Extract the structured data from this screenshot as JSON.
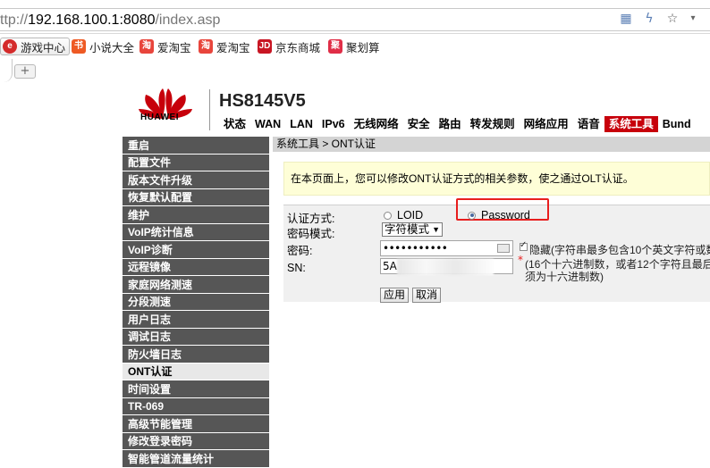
{
  "browser": {
    "url_prefix": "ttp://",
    "url_host": "192.168.100.1:8080",
    "url_path": "/index.asp",
    "bookmarks": [
      {
        "label": "游戏中心",
        "icon": "game-center-icon",
        "color": "#d42b2b"
      },
      {
        "label": "小说大全",
        "icon": "novel-icon",
        "color": "#ee5a24"
      },
      {
        "label": "爱淘宝",
        "icon": "taobao-icon",
        "color": "#e8453c"
      },
      {
        "label": "爱淘宝",
        "icon": "taobao-icon",
        "color": "#e8453c"
      },
      {
        "label": "京东商城",
        "icon": "jd-icon",
        "color": "#c81623"
      },
      {
        "label": "聚划算",
        "icon": "juhuasuan-icon",
        "color": "#e02e47"
      }
    ],
    "new_tab_label": "+"
  },
  "router": {
    "brand": "HUAWEI",
    "model": "HS8145V5",
    "accent_color": "#c7000b",
    "nav": [
      "状态",
      "WAN",
      "LAN",
      "IPv6",
      "无线网络",
      "安全",
      "路由",
      "转发规则",
      "网络应用",
      "语音",
      "系统工具",
      "Bund"
    ],
    "active_nav": "系统工具",
    "sidebar": [
      "重启",
      "配置文件",
      "版本文件升级",
      "恢复默认配置",
      "维护",
      "VoIP统计信息",
      "VoIP诊断",
      "远程镜像",
      "家庭网络测速",
      "分段测速",
      "用户日志",
      "调试日志",
      "防火墙日志",
      "ONT认证",
      "时间设置",
      "TR-069",
      "高级节能管理",
      "修改登录密码",
      "智能管道流量统计"
    ],
    "active_sidebar": "ONT认证",
    "breadcrumb": "系统工具 > ONT认证",
    "info_text": "在本页面上，您可以修改ONT认证方式的相关参数，使之通过OLT认证。",
    "form": {
      "auth_label": "认证方式:",
      "auth_options": [
        "LOID",
        "Password"
      ],
      "auth_selected": "Password",
      "mode_label": "密码模式:",
      "mode_value": "字符模式",
      "password_label": "密码:",
      "password_value": "•••••••••••",
      "hide_label": "隐藏(字符串最多包含10个英文字符或数",
      "sn_label": "SN:",
      "sn_value": "5A",
      "sn_hint_line1": "(16个十六进制数，或者12个字符且最后",
      "sn_hint_line2": "须为十六进制数)",
      "apply_label": "应用",
      "cancel_label": "取消"
    }
  }
}
